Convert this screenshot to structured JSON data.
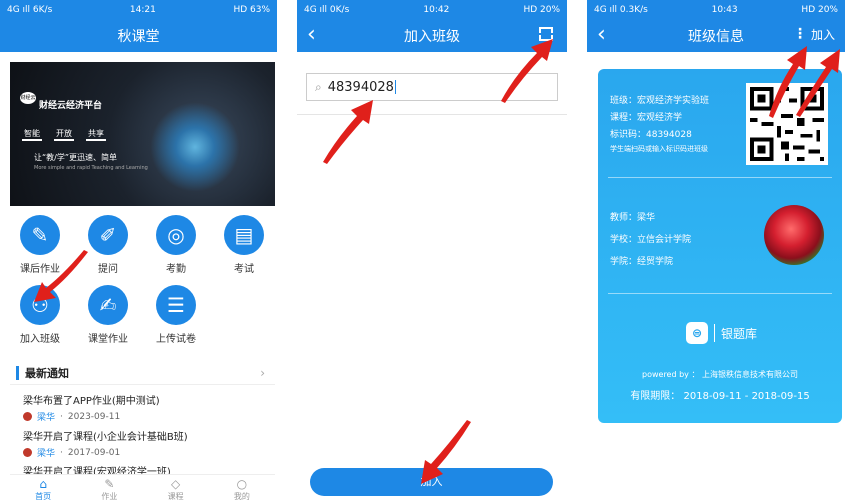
{
  "phone1": {
    "status": {
      "left": "4G ıll 6K/s",
      "time": "14:21",
      "right": "HD 63%"
    },
    "title": "秋课堂",
    "banner": {
      "logo": "财经云",
      "title": "财经云经济平台",
      "tags": [
        "智能",
        "开放",
        "共享"
      ],
      "slogan": "让“教/学”更迅速、简单",
      "english": "More simple and rapid Teaching and Learning"
    },
    "icons": [
      {
        "label": "课后作业",
        "icon": "homework-icon"
      },
      {
        "label": "提问",
        "icon": "question-icon"
      },
      {
        "label": "考勤",
        "icon": "fingerprint-icon"
      },
      {
        "label": "考试",
        "icon": "exam-icon"
      },
      {
        "label": "加入班级",
        "icon": "join-class-icon"
      },
      {
        "label": "课堂作业",
        "icon": "classwork-icon"
      },
      {
        "label": "上传试卷",
        "icon": "upload-paper-icon"
      }
    ],
    "notice_title": "最新通知",
    "notices": [
      {
        "title": "梁华布置了APP作业(期中测试)",
        "author": "梁华",
        "date": "2023-09-11"
      },
      {
        "title": "梁华开启了课程(小企业会计基础B班)",
        "author": "梁华",
        "date": "2017-09-01"
      },
      {
        "title": "梁华开启了课程(宏观经济学一班)",
        "author": "",
        "date": ""
      }
    ],
    "tabs": [
      {
        "label": "首页",
        "icon": "home-icon"
      },
      {
        "label": "作业",
        "icon": "pen-icon"
      },
      {
        "label": "课程",
        "icon": "graduation-cap-icon"
      },
      {
        "label": "我的",
        "icon": "user-icon"
      }
    ]
  },
  "phone2": {
    "status": {
      "left": "4G ıll 0K/s",
      "time": "10:42",
      "right": "HD 20%"
    },
    "title": "加入班级",
    "search_value": "48394028",
    "button": "加入"
  },
  "phone3": {
    "status": {
      "left": "4G ıll 0.3K/s",
      "time": "10:43",
      "right": "HD 20%"
    },
    "title": "班级信息",
    "right_action": "加入",
    "class_name": "班级：宏观经济学实验班",
    "course": "课程：宏观经济学",
    "code": "标识码：48394028",
    "hint": "学生端扫码或输入标识码进班级",
    "teacher": "教师：梁华",
    "school": "学校：立信会计学院",
    "college": "学院：经贸学院",
    "brand": "银题库",
    "powered": "powered by ： 上海银秩信息技术有限公司",
    "validity": "有限期限：  2018-09-11 - 2018-09-15"
  },
  "colors": {
    "primary": "#1e88e5",
    "card": "#2aa7ee",
    "arrow": "#e0201b"
  }
}
